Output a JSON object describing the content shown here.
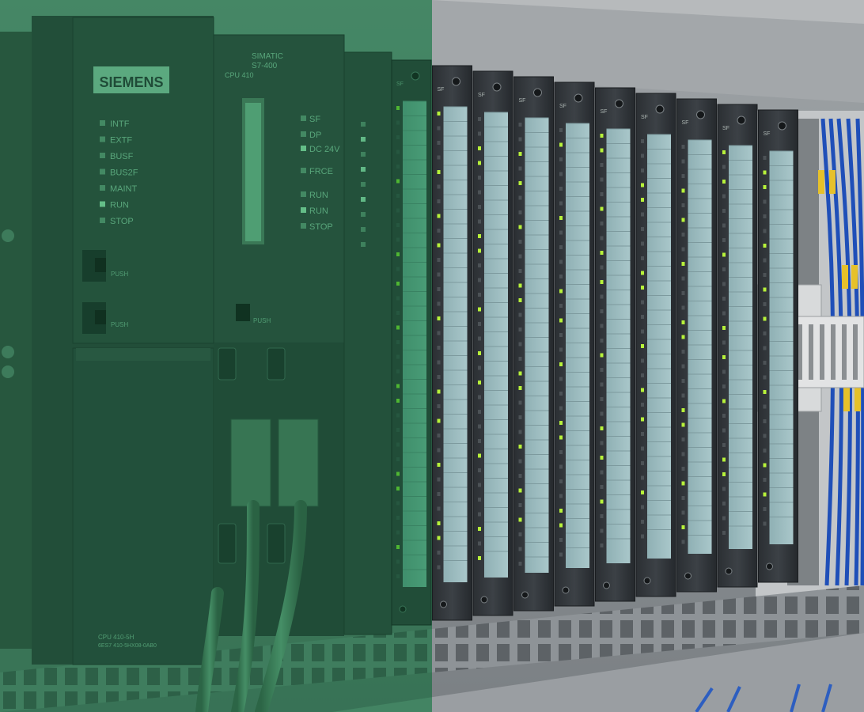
{
  "photo": {
    "subject": "",
    "brand_logo": "SIEMENS",
    "cpu": {
      "series": "SIMATIC",
      "model": "S7-400",
      "name": "CPU 410",
      "footer_label": "CPU 410-5H",
      "order_number": "6ES7 410-5HX08-0AB0",
      "left_leds": [
        "INTF",
        "EXTF",
        "BUSF",
        "BUS2F",
        "MAINT",
        "RUN",
        "STOP"
      ],
      "right_leds": [
        "SF",
        "DP",
        "DC 24V",
        "FRCE",
        "RUN",
        "RUN",
        "STOP"
      ],
      "switches": [
        "PUSH",
        "PUSH"
      ],
      "memory_push": "PUSH"
    },
    "io_module_count": 9,
    "io_module_header": "SF",
    "overlay_color": "#1f9a55"
  }
}
